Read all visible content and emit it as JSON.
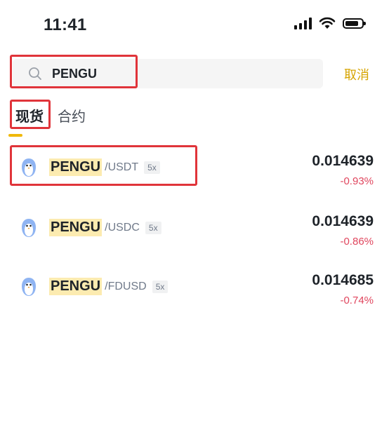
{
  "status_bar": {
    "time": "11:41"
  },
  "search": {
    "value": "PENGU",
    "placeholder": ""
  },
  "cancel_label": "取消",
  "tabs": [
    {
      "label": "现货",
      "active": true
    },
    {
      "label": "合约",
      "active": false
    }
  ],
  "results": [
    {
      "base": "PENGU",
      "quote": "/USDT",
      "leverage": "5x",
      "price": "0.014639",
      "change": "-0.93%"
    },
    {
      "base": "PENGU",
      "quote": "/USDC",
      "leverage": "5x",
      "price": "0.014639",
      "change": "-0.86%"
    },
    {
      "base": "PENGU",
      "quote": "/FDUSD",
      "leverage": "5x",
      "price": "0.014685",
      "change": "-0.74%"
    }
  ],
  "colors": {
    "accent": "#f0b90b",
    "cancel": "#d6a400",
    "negative": "#e0465e",
    "highlight": "#fcebb0",
    "annotation": "#e0343a"
  },
  "icons": [
    "signal-icon",
    "wifi-icon",
    "battery-icon",
    "search-icon",
    "pengu-logo-icon"
  ]
}
